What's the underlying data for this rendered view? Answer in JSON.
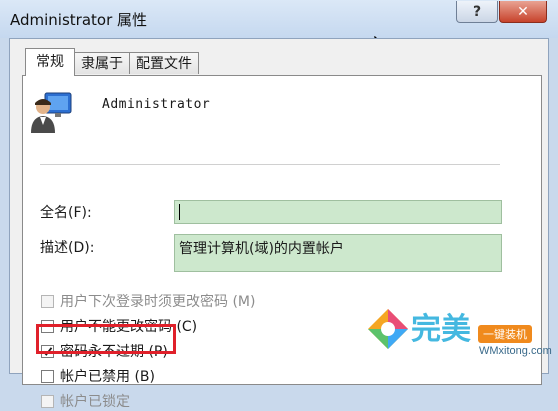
{
  "window": {
    "title": "Administrator 属性",
    "help_label": "?",
    "close_label": "✕"
  },
  "tabs": [
    {
      "label": "常规"
    },
    {
      "label": "隶属于"
    },
    {
      "label": "配置文件"
    }
  ],
  "user": {
    "name": "Administrator",
    "icon": "user-icon"
  },
  "fields": {
    "fullname_label": "全名(F):",
    "fullname_value": "",
    "description_label": "描述(D):",
    "description_value": "管理计算机(域)的内置帐户"
  },
  "options": [
    {
      "label": "用户下次登录时须更改密码 (M)",
      "checked": false,
      "disabled": true
    },
    {
      "label": "用户不能更改密码 (C)",
      "checked": false,
      "disabled": false
    },
    {
      "label": "密码永不过期 (P)",
      "checked": true,
      "disabled": false
    },
    {
      "label": "帐户已禁用 (B)",
      "checked": false,
      "disabled": false
    },
    {
      "label": "帐户已锁定",
      "checked": false,
      "disabled": true
    }
  ],
  "watermark": {
    "brand": "完美",
    "badge": "一键装机",
    "url": "WMxitong.com"
  },
  "colors": {
    "highlight": "#e0202a",
    "field_bg": "#cde8cd",
    "title_bg": "#c9d9ec"
  }
}
